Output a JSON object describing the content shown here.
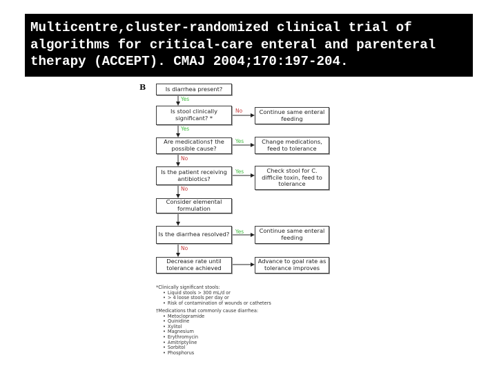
{
  "title": {
    "lines": [
      "Multicentre,cluster-randomized clinical trial of",
      "algorithms for critical-care enteral and parenteral",
      "therapy (ACCEPT). CMAJ 2004;170:197-204."
    ]
  },
  "flowchart": {
    "panel_letter": "B",
    "main_steps": [
      {
        "text": "Is diarrhea present?"
      },
      {
        "text": "Is stool clinically significant? *"
      },
      {
        "text": "Are medications† the possible cause?"
      },
      {
        "text": "Is the patient receiving antibiotics?"
      },
      {
        "text": "Consider elemental formulation"
      },
      {
        "text": "Is the diarrhea resolved?"
      },
      {
        "text": "Decrease rate until tolerance achieved"
      }
    ],
    "side_outcomes": [
      {
        "text": "Continue same enteral feeding"
      },
      {
        "text": "Change medications, feed to tolerance"
      },
      {
        "text": "Check stool for C. difficile toxin, feed to tolerance"
      },
      {
        "text": "Continue same enteral feeding"
      },
      {
        "text": "Advance to goal rate as tolerance improves"
      }
    ],
    "vertical_labels": [
      "Yes",
      "Yes",
      "No",
      "No",
      "No"
    ],
    "side_labels": [
      "No",
      "Yes",
      "Yes",
      "Yes"
    ],
    "colors": {
      "yes": "#3dbb3d",
      "no": "#c83a3a",
      "line": "#222222"
    }
  },
  "footnotes": {
    "stool_heading": "*Clinically significant stools:",
    "stool_items": [
      "Liquid stools > 300 mL/d or",
      "> 4 loose stools per day or",
      "Risk of contamination of wounds or catheters"
    ],
    "meds_heading": "†Medications that commonly cause diarrhea:",
    "meds_items": [
      "Metoclopramide",
      "Quinidine",
      "Xylitol",
      "Magnesium",
      "Erythromycin",
      "Amitriptyline",
      "Sorbitol",
      "Phosphorus"
    ]
  }
}
